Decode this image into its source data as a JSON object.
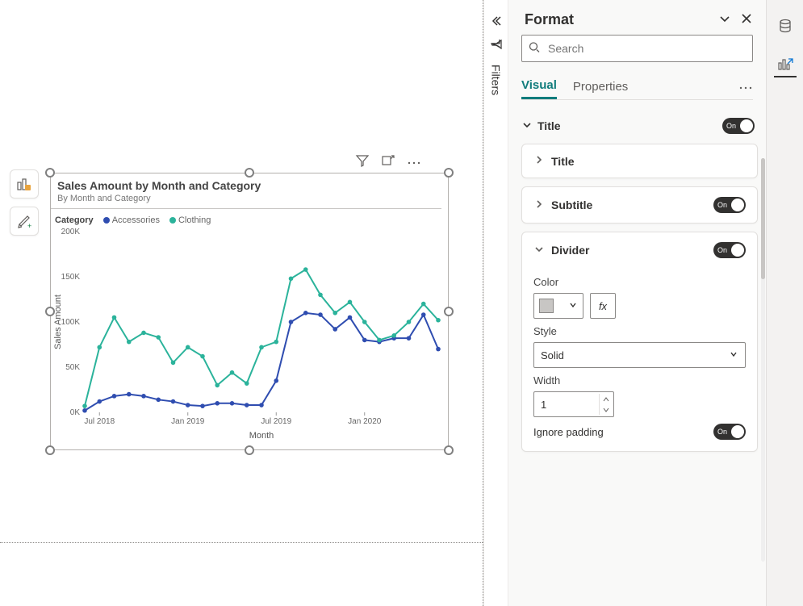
{
  "canvas": {
    "visual": {
      "title": "Sales Amount by Month and Category",
      "subtitle": "By Month and Category",
      "legend_title": "Category",
      "xlabel": "Month",
      "ylabel": "Sales Amount"
    },
    "header_icons": {
      "filter": "filter-icon",
      "focus": "focus-mode-icon",
      "more": "more-icon"
    }
  },
  "chart_data": {
    "type": "line",
    "title": "Sales Amount by Month and Category",
    "subtitle": "By Month and Category",
    "xlabel": "Month",
    "ylabel": "Sales Amount",
    "ylim": [
      0,
      200000
    ],
    "y_ticks": [
      "0K",
      "50K",
      "100K",
      "150K",
      "200K"
    ],
    "x_tick_labels": [
      "Jul 2018",
      "Jan 2019",
      "Jul 2019",
      "Jan 2020"
    ],
    "x_tick_positions": [
      1,
      7,
      13,
      19
    ],
    "categories": [
      "Jun 2018",
      "Jul 2018",
      "Aug 2018",
      "Sep 2018",
      "Oct 2018",
      "Nov 2018",
      "Dec 2018",
      "Jan 2019",
      "Feb 2019",
      "Mar 2019",
      "Apr 2019",
      "May 2019",
      "Jun 2019",
      "Jul 2019",
      "Aug 2019",
      "Sep 2019",
      "Oct 2019",
      "Nov 2019",
      "Dec 2019",
      "Jan 2020",
      "Feb 2020",
      "Mar 2020",
      "Apr 2020",
      "May 2020",
      "Jun 2020"
    ],
    "series": [
      {
        "name": "Accessories",
        "color": "#2f4db0",
        "values": [
          2000,
          12000,
          18000,
          20000,
          18000,
          14000,
          12000,
          8000,
          7000,
          10000,
          10000,
          8000,
          8000,
          35000,
          100000,
          110000,
          108000,
          92000,
          105000,
          80000,
          78000,
          82000,
          82000,
          108000,
          70000
        ]
      },
      {
        "name": "Clothing",
        "color": "#2bb39b",
        "values": [
          7000,
          72000,
          105000,
          78000,
          88000,
          83000,
          55000,
          72000,
          62000,
          30000,
          44000,
          32000,
          72000,
          78000,
          148000,
          158000,
          130000,
          110000,
          122000,
          100000,
          80000,
          85000,
          100000,
          120000,
          102000
        ]
      }
    ],
    "legend_position": "top-left"
  },
  "filters_panel_label": "Filters",
  "format_pane": {
    "title": "Format",
    "search_placeholder": "Search",
    "tabs": {
      "visual": "Visual",
      "properties": "Properties",
      "active": "visual"
    },
    "sections": {
      "title": {
        "label": "Title",
        "expanded": true,
        "on_text": "On"
      },
      "title_sub": {
        "label": "Title"
      },
      "subtitle": {
        "label": "Subtitle",
        "on_text": "On"
      },
      "divider": {
        "label": "Divider",
        "expanded": true,
        "on_text": "On",
        "color_label": "Color",
        "color_value": "#c8c6c4",
        "fx_label": "fx",
        "style_label": "Style",
        "style_value": "Solid",
        "width_label": "Width",
        "width_value": "1",
        "ignore_padding_label": "Ignore padding",
        "ignore_padding_on_text": "On"
      }
    }
  }
}
